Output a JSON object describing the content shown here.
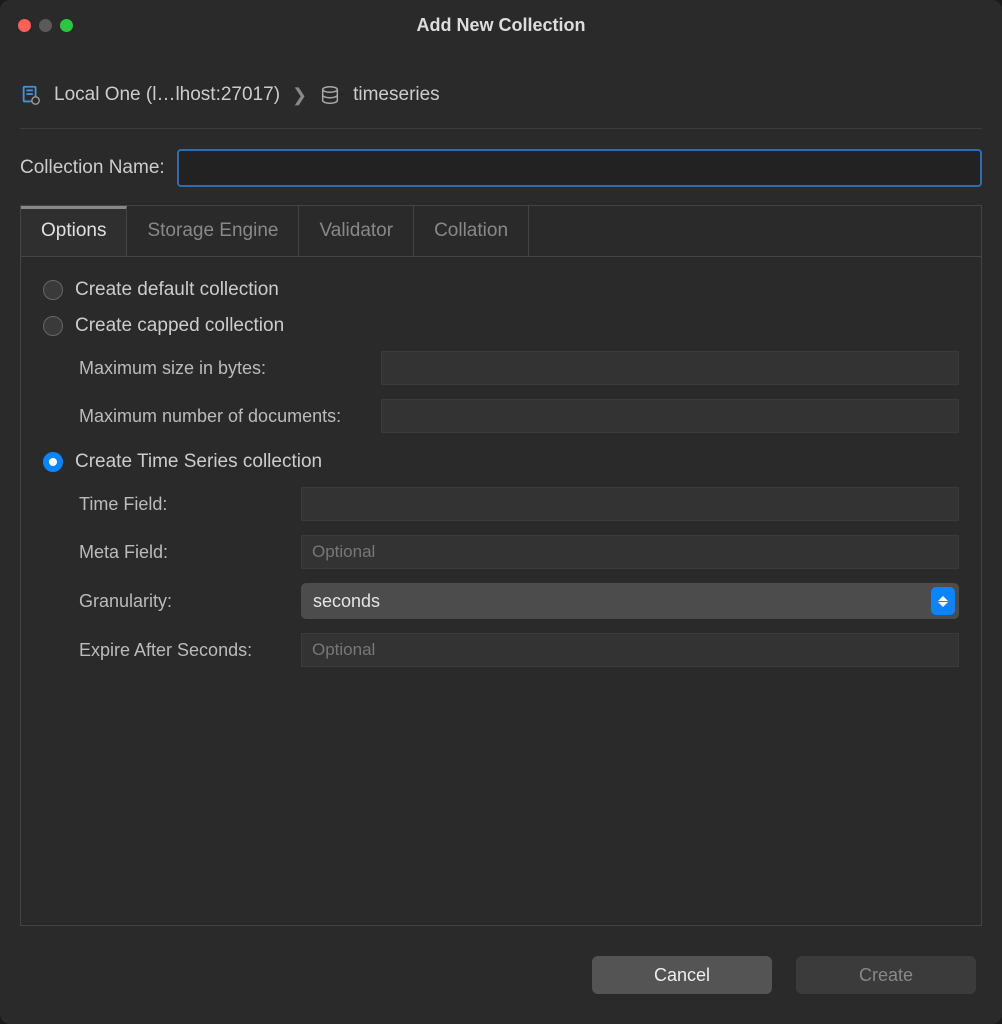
{
  "title": "Add New Collection",
  "breadcrumb": {
    "connection": "Local One (l…lhost:27017)",
    "database": "timeseries"
  },
  "collection_name": {
    "label": "Collection Name:",
    "value": ""
  },
  "tabs": [
    {
      "label": "Options",
      "active": true
    },
    {
      "label": "Storage Engine",
      "active": false
    },
    {
      "label": "Validator",
      "active": false
    },
    {
      "label": "Collation",
      "active": false
    }
  ],
  "options": {
    "default_label": "Create default collection",
    "capped": {
      "label": "Create capped collection",
      "max_size_label": "Maximum size in bytes:",
      "max_size_value": "",
      "max_docs_label": "Maximum number of documents:",
      "max_docs_value": ""
    },
    "timeseries": {
      "label": "Create Time Series collection",
      "time_field_label": "Time Field:",
      "time_field_value": "",
      "meta_field_label": "Meta Field:",
      "meta_field_value": "",
      "meta_field_placeholder": "Optional",
      "granularity_label": "Granularity:",
      "granularity_value": "seconds",
      "expire_label": "Expire After Seconds:",
      "expire_value": "",
      "expire_placeholder": "Optional"
    },
    "selected": "timeseries"
  },
  "footer": {
    "cancel": "Cancel",
    "create": "Create"
  }
}
